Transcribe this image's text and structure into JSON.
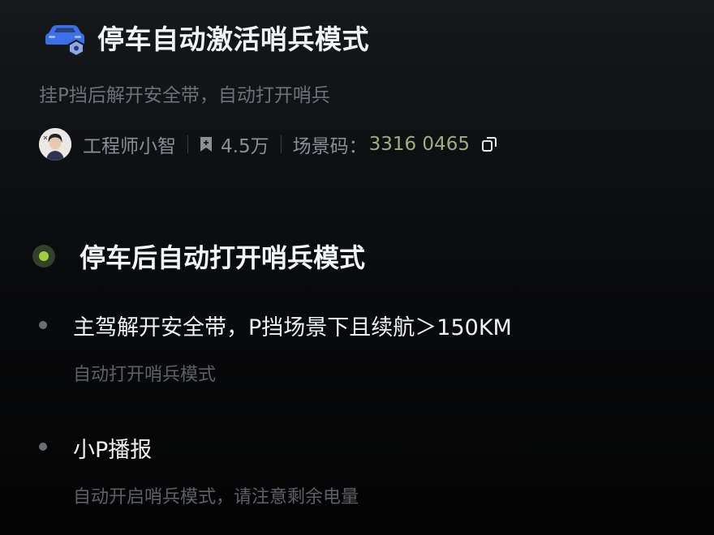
{
  "header": {
    "title": "停车自动激活哨兵模式",
    "subtitle": "挂P挡后解开安全带，自动打开哨兵",
    "icon": "car-shield-icon"
  },
  "meta": {
    "author": "工程师小智",
    "favorites": "4.5万",
    "scene_code_label": "场景码：",
    "scene_code": "3316 0465"
  },
  "section": {
    "title": "停车后自动打开哨兵模式",
    "accent_color": "#9fcf3f"
  },
  "steps": [
    {
      "title": "主驾解开安全带，P挡场景下且续航＞150KM",
      "description": "自动打开哨兵模式"
    },
    {
      "title": "小P播报",
      "description": "自动开启哨兵模式，请注意剩余电量"
    }
  ]
}
